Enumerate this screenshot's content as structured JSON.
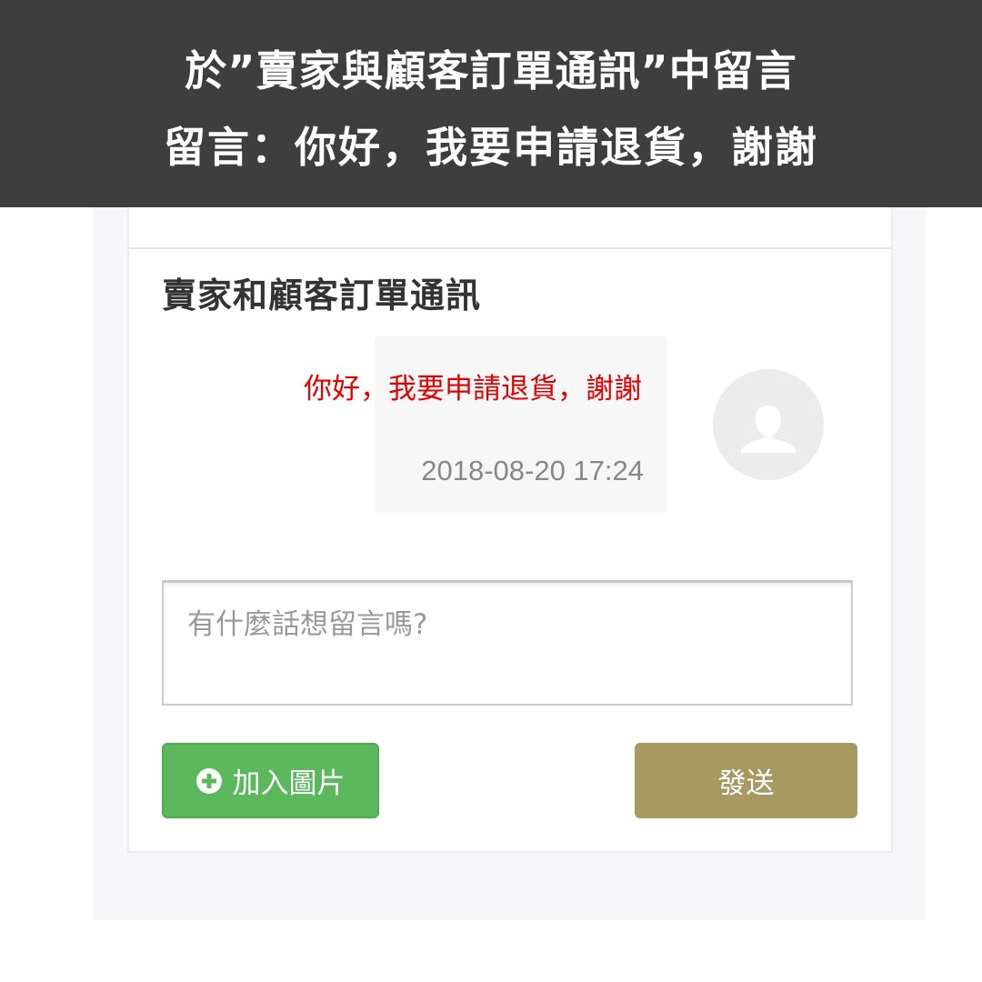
{
  "banner": {
    "line1": "於”賣家與顧客訂單通訊”中留言",
    "line2": "留言：你好，我要申請退貨，謝謝"
  },
  "section": {
    "title": "賣家和顧客訂單通訊"
  },
  "message": {
    "text": "你好，我要申請退貨，謝謝",
    "timestamp": "2018-08-20 17:24",
    "avatar_icon": "user-silhouette-icon"
  },
  "compose": {
    "placeholder": "有什麼話想留言嗎?",
    "add_image_label": "加入圖片",
    "add_image_icon": "plus-circle-icon",
    "send_label": "發送"
  },
  "colors": {
    "banner_bg": "#3e3e3e",
    "message_text": "#e30000",
    "add_button": "#5cb85c",
    "send_button": "#a69a62"
  }
}
